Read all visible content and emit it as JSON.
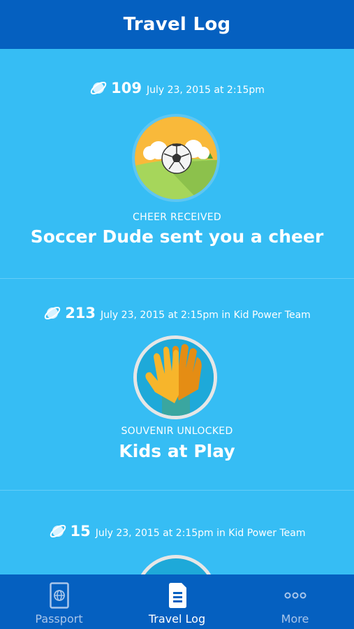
{
  "header": {
    "title": "Travel Log"
  },
  "entries": [
    {
      "points": "109",
      "date": "July 23, 2015 at 2:15pm",
      "kicker": "CHEER RECEIVED",
      "headline": "Soccer Dude sent you a cheer",
      "badge_icon": "soccer-ball-icon"
    },
    {
      "points": "213",
      "date": "July 23, 2015 at 2:15pm in Kid Power Team",
      "kicker": "SOUVENIR UNLOCKED",
      "headline": "Kids at Play",
      "badge_icon": "high-five-icon"
    },
    {
      "points": "15",
      "date": "July 23, 2015 at 2:15pm in Kid Power Team",
      "kicker": "",
      "headline": "",
      "badge_icon": ""
    }
  ],
  "tabs": [
    {
      "label": "Passport",
      "icon": "passport-icon",
      "active": false
    },
    {
      "label": "Travel Log",
      "icon": "travel-log-icon",
      "active": true
    },
    {
      "label": "More",
      "icon": "more-dots-icon",
      "active": false
    }
  ],
  "colors": {
    "header": "#0560c0",
    "background": "#36bdf4",
    "tabbar": "#0560c0"
  }
}
